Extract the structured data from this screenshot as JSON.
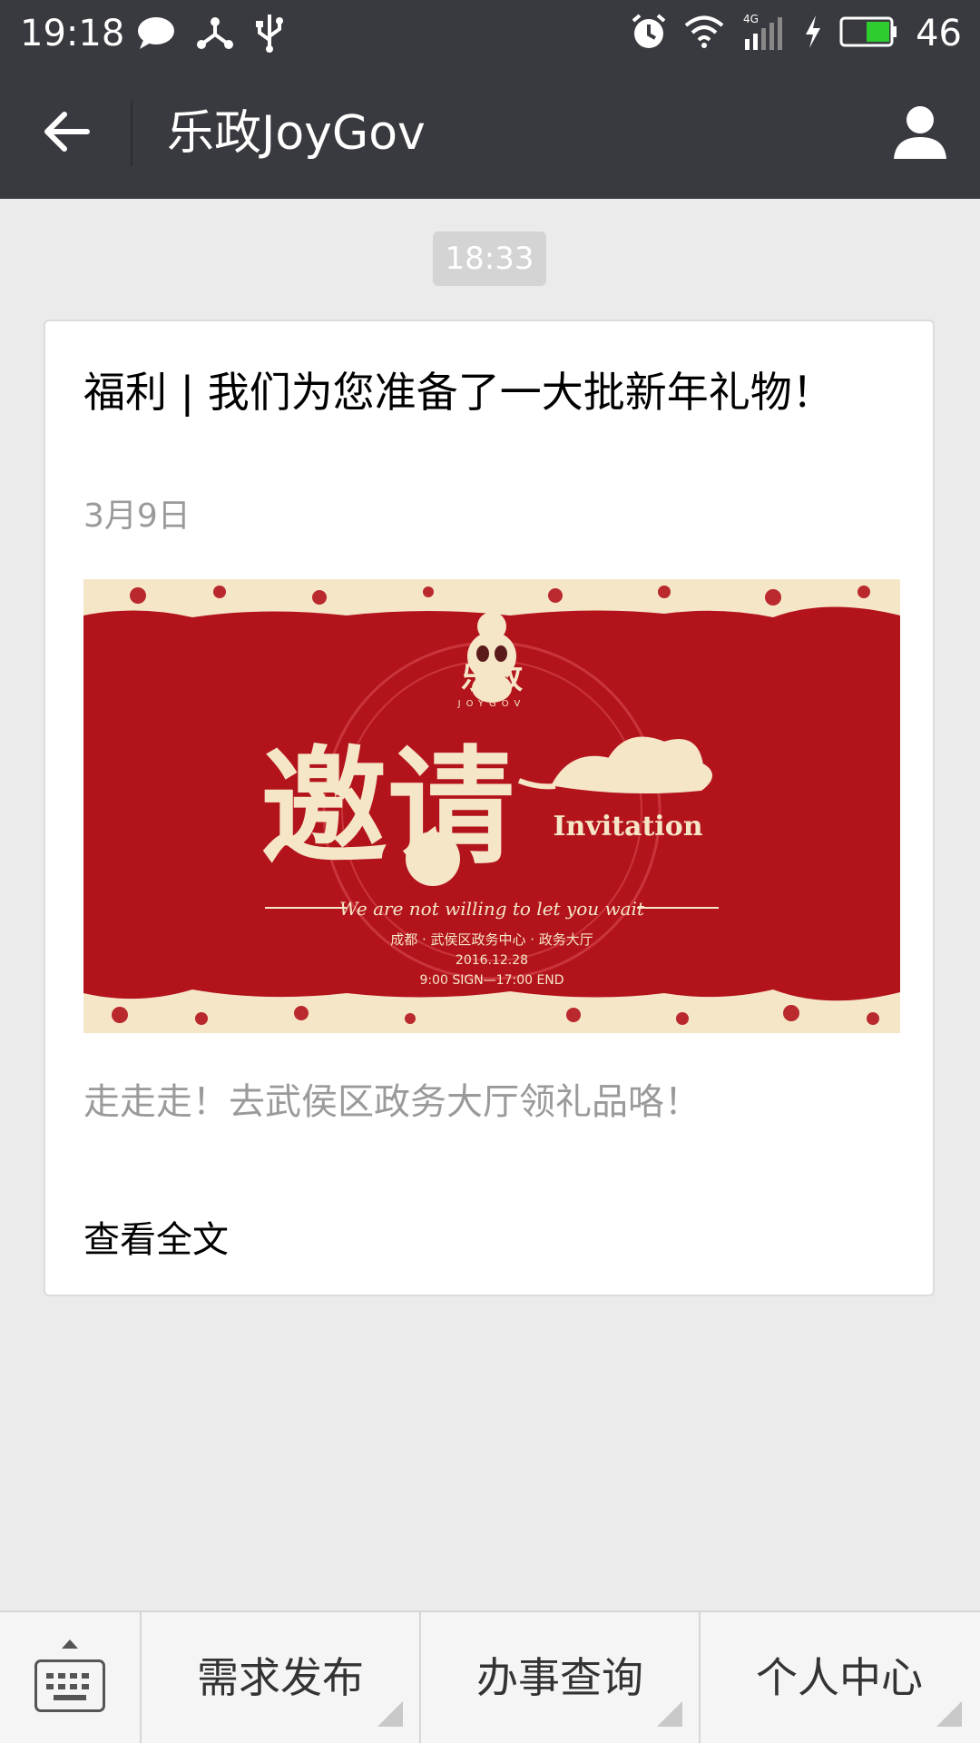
{
  "status_bar": {
    "time": "19:18",
    "battery_level": "46",
    "network": "4G",
    "icons": [
      "chat-bubble-icon",
      "share-icon",
      "usb-icon",
      "alarm-icon",
      "wifi-icon",
      "signal-icon",
      "charging-icon",
      "battery-icon"
    ]
  },
  "header": {
    "title": "乐政JoyGov",
    "back_icon": "back-arrow-icon",
    "profile_icon": "person-icon"
  },
  "message": {
    "time": "18:33"
  },
  "article": {
    "title": "福利 | 我们为您准备了一大批新年礼物！",
    "date": "3月9日",
    "summary": "走走走！去武侯区政务大厅领礼品咯！",
    "read_more": "查看全文",
    "cover": {
      "brand": "乐政",
      "brand_sub": "JOYGOV",
      "calligraphy": "邀请",
      "invitation": "Invitation",
      "tagline": "We are not willing to let you wait",
      "location": "成都 · 武侯区政务中心 · 政务大厅",
      "event_date": "2016.12.28",
      "hours": "9:00 SIGN—17:00 END"
    }
  },
  "bottom_menu": {
    "keyboard_icon": "keyboard-icon",
    "items": [
      {
        "label": "需求发布"
      },
      {
        "label": "办事查询"
      },
      {
        "label": "个人中心"
      }
    ]
  },
  "colors": {
    "bar": "#393a3f",
    "background": "#ebebeb",
    "cover_red": "#b3141c",
    "cover_cream": "#f6e6c8",
    "battery_green": "#2ecc2e"
  }
}
